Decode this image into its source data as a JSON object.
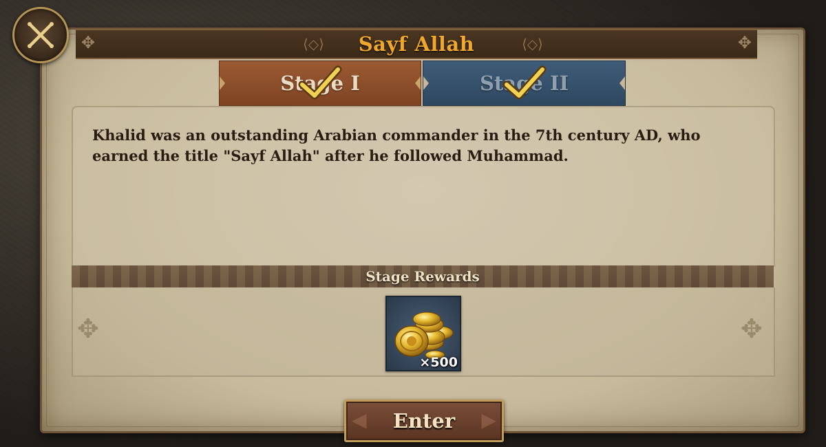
{
  "dialog": {
    "title": "Sayf Allah",
    "close_icon": "close-x-icon",
    "colors": {
      "title": "#f0a72a",
      "tab_active": "#8f4f2c",
      "tab_inactive": "#375470",
      "check": "#f2d255"
    }
  },
  "tabs": [
    {
      "label": "Stage I",
      "completed": true,
      "active": true,
      "icon": "checkmark-icon"
    },
    {
      "label": "Stage II",
      "completed": true,
      "active": false,
      "icon": "checkmark-icon"
    }
  ],
  "description": "Khalid was an outstanding Arabian commander in the 7th century AD, who earned the title \"Sayf Allah\" after he followed Muhammad.",
  "rewards": {
    "title": "Stage Rewards",
    "items": [
      {
        "icon": "gold-coins-icon",
        "quantity": "×500"
      }
    ]
  },
  "actions": {
    "enter_label": "Enter"
  }
}
